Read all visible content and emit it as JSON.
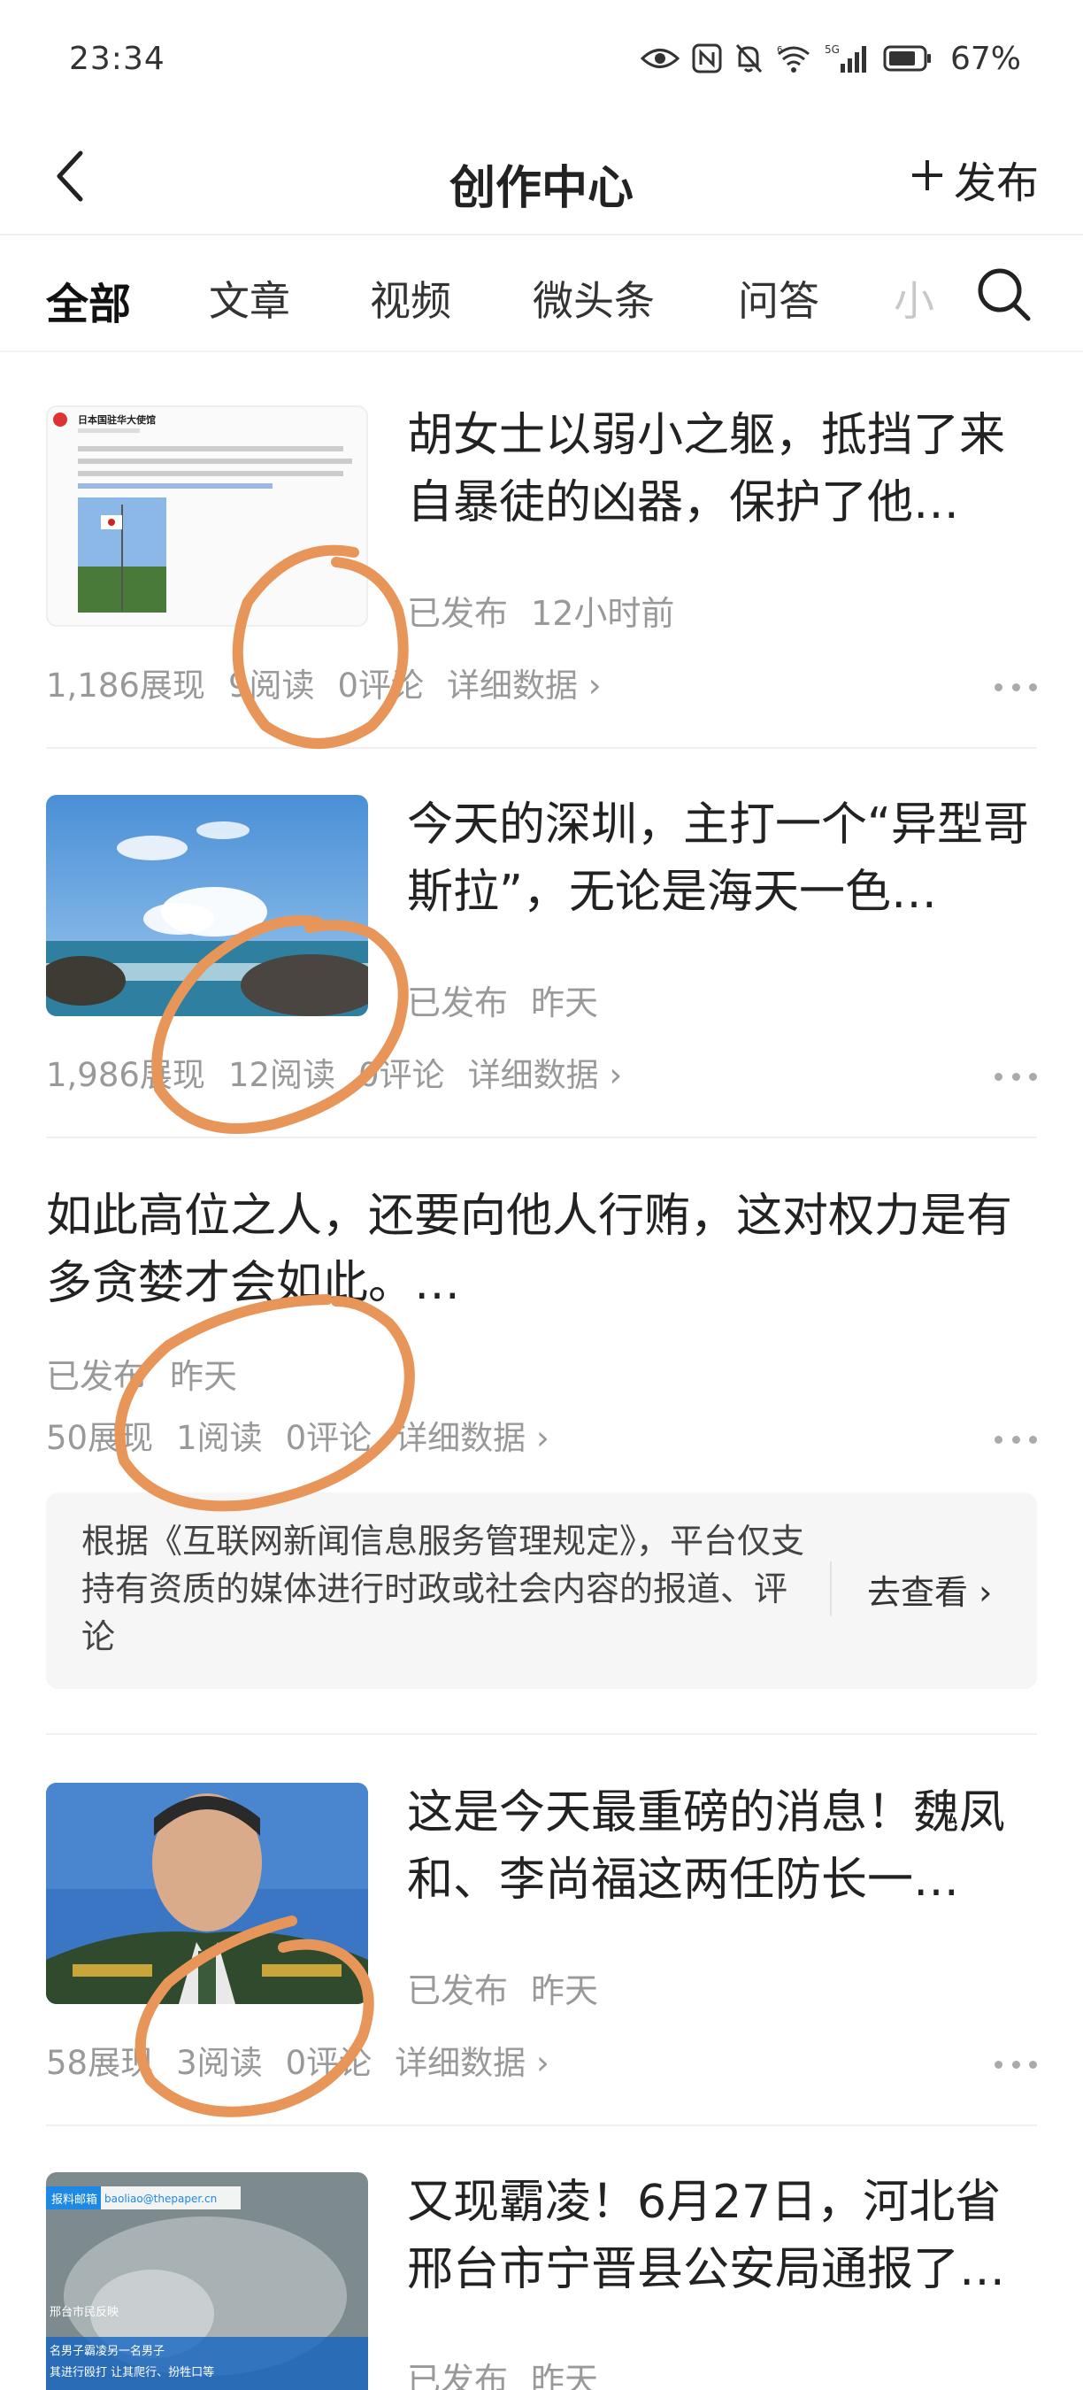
{
  "status_bar": {
    "time": "23:34",
    "battery_percent": "67%",
    "icons": [
      "eye-icon",
      "nfc-icon",
      "mute-icon",
      "wifi-6-icon",
      "signal-5g-icon",
      "battery-icon"
    ]
  },
  "header": {
    "title": "创作中心",
    "publish_label": "发布",
    "back_icon": "chevron-left-icon"
  },
  "tabs": {
    "items": [
      "全部",
      "文章",
      "视频",
      "微头条",
      "问答"
    ],
    "overflow_label": "小",
    "active_index": 0
  },
  "feed": [
    {
      "headline": "胡女士以弱小之躯，抵挡了来自暴徒的凶器，保护了他…",
      "status": "已发布",
      "time": "12小时前",
      "impressions": "1,186展现",
      "reads": "9阅读",
      "comments": "0评论",
      "details": "详细数据 ›"
    },
    {
      "headline": "今天的深圳，主打一个“异型哥斯拉”，无论是海天一色…",
      "status": "已发布",
      "time": "昨天",
      "impressions": "1,986展现",
      "reads": "12阅读",
      "comments": "0评论",
      "details": "详细数据 ›"
    },
    {
      "headline": "如此高位之人，还要向他人行贿，这对权力是有多贪婪才会如此。…",
      "status": "已发布",
      "time": "昨天",
      "impressions": "50展现",
      "reads": "1阅读",
      "comments": "0评论",
      "details": "详细数据 ›"
    },
    {
      "headline": "这是今天最重磅的消息！魏凤和、李尚福这两任防长一…",
      "status": "已发布",
      "time": "昨天",
      "impressions": "58展现",
      "reads": "3阅读",
      "comments": "0评论",
      "details": "详细数据 ›"
    },
    {
      "headline": "又现霸凌！6月27日，河北省邢台市宁晋县公安局通报了…",
      "status": "已发布",
      "time": "昨天"
    }
  ],
  "notice": {
    "text": "根据《互联网新闻信息服务管理规定》，平台仅支持有资质的媒体进行时政或社会内容的报道、评论",
    "link": "去查看 ›"
  },
  "thumb_text": {
    "weibo_account": "日本国驻华大使馆",
    "report_badge": "报料邮箱",
    "report_email": "baoliao@thepaper.cn",
    "caption_1": "邢台市民反映",
    "caption_2": "名男子霸凌另一名男子",
    "caption_3": "其进行殴打 让其爬行、扮牲口等"
  },
  "colors": {
    "annotation_orange": "#e8955a",
    "text_primary": "#222222",
    "text_secondary": "#999999"
  }
}
